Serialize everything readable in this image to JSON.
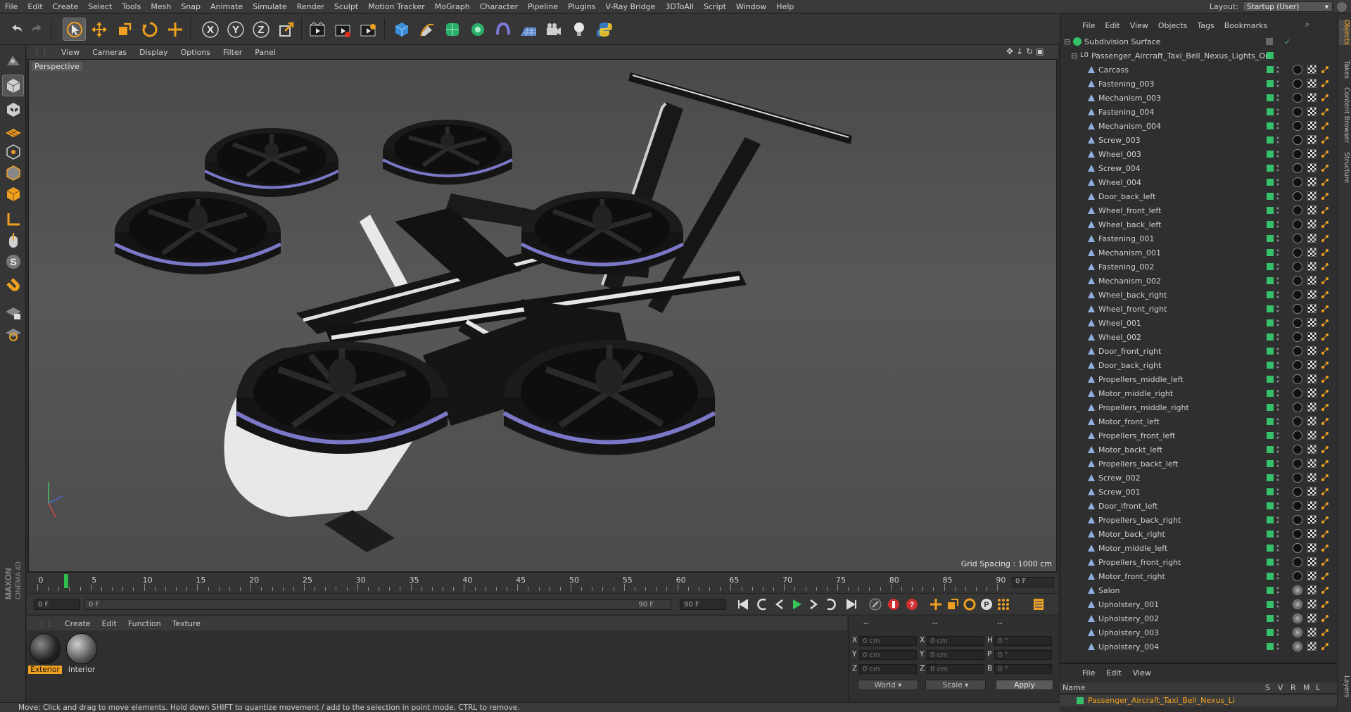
{
  "menubar": {
    "items": [
      "File",
      "Edit",
      "Create",
      "Select",
      "Tools",
      "Mesh",
      "Snap",
      "Animate",
      "Simulate",
      "Render",
      "Sculpt",
      "Motion Tracker",
      "MoGraph",
      "Character",
      "Pipeline",
      "Plugins",
      "V-Ray Bridge",
      "3DToAll",
      "Script",
      "Window",
      "Help"
    ],
    "layout_label": "Layout:",
    "layout_value": "Startup (User)"
  },
  "toolbar": {
    "icons": [
      "undo-icon",
      "redo-icon",
      "select-arrow-icon",
      "move-icon",
      "scale-icon",
      "rotate-icon",
      "create-icon",
      "x-axis-icon",
      "y-axis-icon",
      "z-axis-icon",
      "coordinate-system-icon",
      "render-view-icon",
      "render-picture-viewer-icon",
      "edit-render-settings-icon",
      "cube-icon",
      "pen-icon",
      "subdivision-icon",
      "cloner-icon",
      "deformer-icon",
      "floor-icon",
      "camera-icon",
      "light-icon",
      "python-icon"
    ],
    "axis_x": "X",
    "axis_y": "Y",
    "axis_z": "Z"
  },
  "viewport": {
    "menu": [
      "View",
      "Cameras",
      "Display",
      "Options",
      "Filter",
      "Panel"
    ],
    "label": "Perspective",
    "grid_spacing": "Grid Spacing : 1000 cm"
  },
  "timeline": {
    "ticks": [
      "0",
      "5",
      "10",
      "15",
      "20",
      "25",
      "30",
      "35",
      "40",
      "45",
      "50",
      "55",
      "60",
      "65",
      "70",
      "75",
      "80",
      "85",
      "90"
    ],
    "current_frame": "0 F"
  },
  "transport": {
    "start_field": "0 F",
    "range_start": "0 F",
    "range_end": "90 F",
    "end_field": "90 F"
  },
  "materials": {
    "menu": [
      "Create",
      "Edit",
      "Function",
      "Texture"
    ],
    "items": [
      {
        "name": "Exterior",
        "selected": true
      },
      {
        "name": "Interior",
        "selected": false
      }
    ]
  },
  "coordinates": {
    "header_a": "--",
    "header_b": "--",
    "header_c": "--",
    "rows": [
      {
        "l1": "X",
        "v1": "0 cm",
        "l2": "X",
        "v2": "0 cm",
        "l3": "H",
        "v3": "0 °"
      },
      {
        "l1": "Y",
        "v1": "0 cm",
        "l2": "Y",
        "v2": "0 cm",
        "l3": "P",
        "v3": "0 °"
      },
      {
        "l1": "Z",
        "v1": "0 cm",
        "l2": "Z",
        "v2": "0 cm",
        "l3": "B",
        "v3": "0 °"
      }
    ],
    "mode_select": "World",
    "scale_select": "Scale",
    "apply_label": "Apply"
  },
  "statusbar": {
    "text": "Move: Click and drag to move elements. Hold down SHIFT to quantize movement / add to the selection in point mode, CTRL to remove."
  },
  "object_manager": {
    "menu": [
      "File",
      "Edit",
      "View",
      "Objects",
      "Tags",
      "Bookmarks"
    ],
    "root": "Subdivision Surface",
    "group": "Passenger_Aircraft_Taxi_Bell_Nexus_Lights_On",
    "objects": [
      "Carcass",
      "Fastening_003",
      "Mechanism_003",
      "Fastening_004",
      "Mechanism_004",
      "Screw_003",
      "Wheel_003",
      "Screw_004",
      "Wheel_004",
      "Door_back_left",
      "Wheel_front_left",
      "Wheel_back_left",
      "Fastening_001",
      "Mechanism_001",
      "Fastening_002",
      "Mechanism_002",
      "Wheel_back_right",
      "Wheel_front_right",
      "Wheel_001",
      "Wheel_002",
      "Door_front_right",
      "Door_back_right",
      "Propellers_middle_left",
      "Motor_middle_right",
      "Propellers_middle_right",
      "Motor_front_left",
      "Propellers_front_left",
      "Motor_backt_left",
      "Propellers_backt_left",
      "Screw_002",
      "Screw_001",
      "Door_lfront_left",
      "Propellers_back_right",
      "Motor_back_right",
      "Motor_middle_left",
      "Propellers_front_right",
      "Motor_front_right",
      "Salon",
      "Upholstery_001",
      "Upholstery_002",
      "Upholstery_003",
      "Upholstery_004"
    ]
  },
  "side_tabs": [
    "Objects",
    "Takes",
    "Content Browser",
    "Structure",
    "Layers"
  ],
  "layers": {
    "menu": [
      "File",
      "Edit",
      "View"
    ],
    "col_name": "Name",
    "cols": [
      "S",
      "V",
      "R",
      "M",
      "L"
    ],
    "row": "Passenger_Aircraft_Taxi_Bell_Nexus_Lights_On"
  },
  "colors": {
    "accent_green": "#35c06a",
    "selected_orange": "#f0a020",
    "toolbar_bg": "#363636"
  }
}
